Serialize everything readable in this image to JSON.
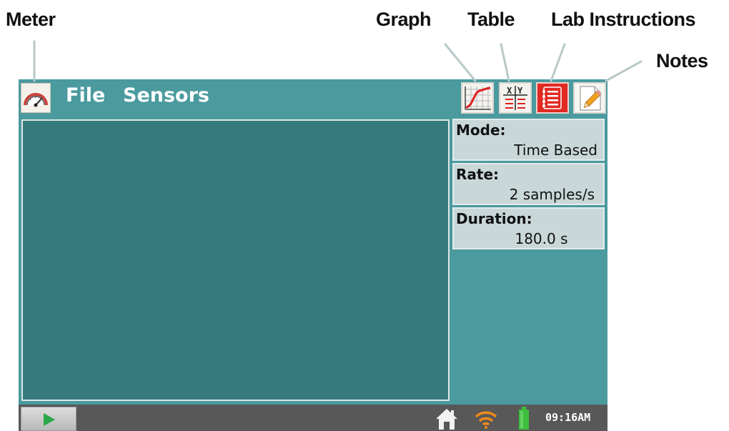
{
  "callouts": {
    "meter": "Meter",
    "graph": "Graph",
    "table": "Table",
    "lab_instructions": "Lab Instructions",
    "notes": "Notes"
  },
  "menubar": {
    "items": [
      "File",
      "Sensors"
    ],
    "tools": [
      {
        "name": "graph",
        "icon": "graph-icon"
      },
      {
        "name": "table",
        "icon": "xy-table-icon",
        "glyph": "X|Y"
      },
      {
        "name": "lab_instructions",
        "icon": "lab-instructions-icon"
      },
      {
        "name": "notes",
        "icon": "notes-icon"
      }
    ],
    "meter_icon": "meter-gauge-icon"
  },
  "settings": {
    "mode": {
      "label": "Mode:",
      "value": "Time Based"
    },
    "rate": {
      "label": "Rate:",
      "value": "2 samples/s"
    },
    "duration": {
      "label": "Duration:",
      "value": "180.0 s"
    }
  },
  "statusbar": {
    "play_icon": "play-icon",
    "icons": [
      "home-icon",
      "wifi-icon",
      "battery-icon"
    ],
    "clock": "09:16AM"
  },
  "colors": {
    "app_teal": "#4a9a9e",
    "meter_area": "#367a7e",
    "info_panel": "#c9d7d9",
    "statusbar": "#585858",
    "lab_red": "#e02a22",
    "play_green": "#2aa84a",
    "battery_green": "#3dbf3d"
  }
}
